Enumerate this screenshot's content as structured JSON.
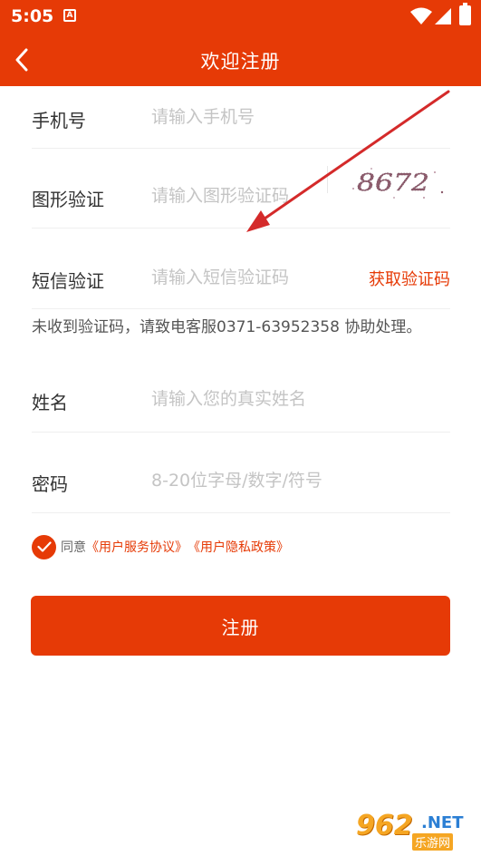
{
  "status_bar": {
    "time": "5:05",
    "notification_icon": "A"
  },
  "nav": {
    "title": "欢迎注册",
    "back_icon": "chevron-left-icon"
  },
  "form": {
    "phone": {
      "label": "手机号",
      "placeholder": "请输入手机号",
      "value": ""
    },
    "captcha": {
      "label": "图形验证",
      "placeholder": "请输入图形验证码",
      "value": "",
      "image_text": "8672"
    },
    "sms": {
      "label": "短信验证",
      "placeholder": "请输入短信验证码",
      "value": "",
      "button": "获取验证码"
    },
    "notice": "未收到验证码，请致电客服0371-63952358 协助处理。",
    "name": {
      "label": "姓名",
      "placeholder": "请输入您的真实姓名",
      "value": ""
    },
    "password": {
      "label": "密码",
      "placeholder": "8-20位字母/数字/符号",
      "value": ""
    }
  },
  "agreement": {
    "checked": true,
    "prefix": "同意",
    "service_link": "《用户服务协议》",
    "privacy_link": "《用户隐私政策》"
  },
  "submit_label": "注册",
  "colors": {
    "accent": "#e63a06",
    "placeholder": "#c4c4c4",
    "arrow": "#d42a2a"
  },
  "watermark": {
    "number": "962",
    "suffix": ".NET",
    "subtitle": "乐游网"
  }
}
